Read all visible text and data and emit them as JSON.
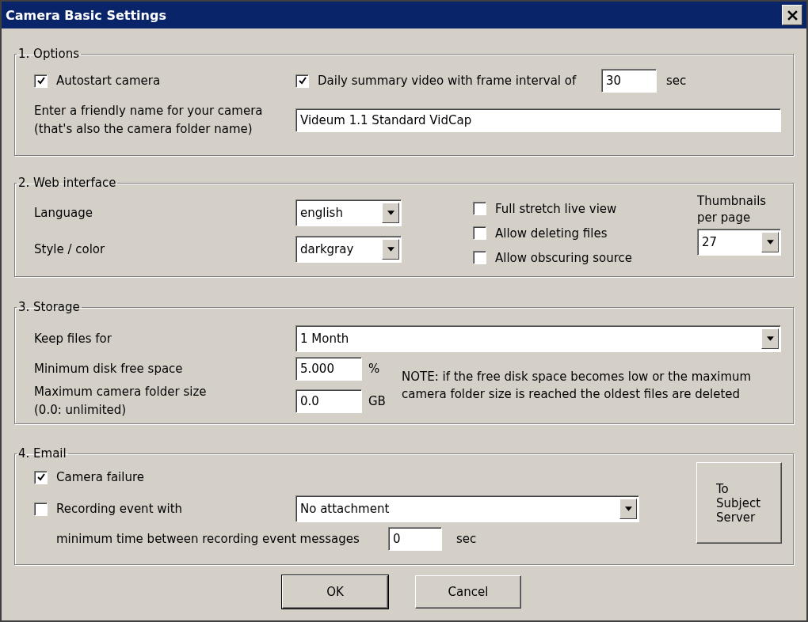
{
  "window": {
    "title": "Camera Basic Settings"
  },
  "options": {
    "legend": "1. Options",
    "autostart": {
      "label": "Autostart camera",
      "checked": true
    },
    "daily_summary": {
      "label": "Daily summary video with frame interval of",
      "checked": true
    },
    "frame_interval": {
      "value": "30",
      "unit": "sec"
    },
    "friendly_name": {
      "label": "Enter a friendly name for your camera\n(that's also the camera folder name)",
      "value": "Videum 1.1 Standard VidCap"
    }
  },
  "web_interface": {
    "legend": "2. Web interface",
    "language": {
      "label": "Language",
      "value": "english"
    },
    "style": {
      "label": "Style / color",
      "value": "darkgray"
    },
    "checkboxes": [
      {
        "label": "Full stretch live view",
        "checked": false
      },
      {
        "label": "Allow deleting files",
        "checked": false
      },
      {
        "label": "Allow obscuring source",
        "checked": false
      }
    ],
    "thumbnails": {
      "label": "Thumbnails\nper page",
      "value": "27"
    }
  },
  "storage": {
    "legend": "3. Storage",
    "keep_files": {
      "label": "Keep files for",
      "value": "1 Month"
    },
    "min_disk": {
      "label": "Minimum disk free space",
      "value": "5.000",
      "unit": "%"
    },
    "max_folder": {
      "label": "Maximum camera folder size\n(0.0: unlimited)",
      "value": "0.0",
      "unit": "GB"
    },
    "note": "NOTE: if the free disk space becomes low or the maximum\ncamera folder size is reached the oldest files are deleted"
  },
  "email": {
    "legend": "4. Email",
    "camera_failure": {
      "label": "Camera failure",
      "checked": true
    },
    "recording_event": {
      "label": "Recording event with",
      "checked": false,
      "attachment": "No attachment"
    },
    "min_time": {
      "label": "minimum time between recording event messages",
      "value": "0",
      "unit": "sec"
    },
    "side_button": "To\nSubject\nServer"
  },
  "buttons": [
    {
      "label": "OK",
      "default": true
    },
    {
      "label": "Cancel",
      "default": false
    }
  ]
}
